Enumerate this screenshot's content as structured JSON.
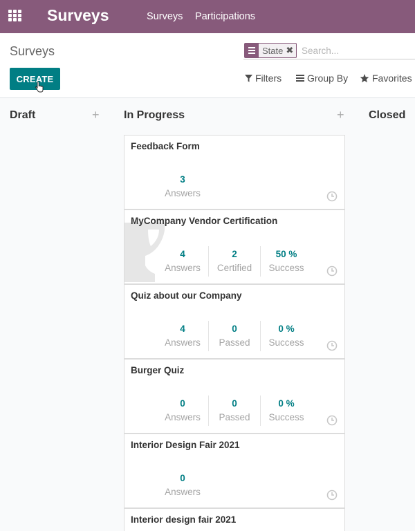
{
  "navbar": {
    "app_title": "Surveys",
    "menu": [
      "Surveys",
      "Participations"
    ]
  },
  "control_panel": {
    "breadcrumb": "Surveys",
    "search_facet_label": "State",
    "search_placeholder": "Search...",
    "create_label": "CREATE",
    "filters_label": "Filters",
    "group_by_label": "Group By",
    "favorites_label": "Favorites"
  },
  "kanban": {
    "columns": [
      {
        "title": "Draft"
      },
      {
        "title": "In Progress"
      },
      {
        "title": "Closed"
      }
    ],
    "cards": [
      {
        "title": "Feedback Form",
        "stats": [
          {
            "value": "3",
            "label": "Answers"
          }
        ]
      },
      {
        "title": "MyCompany Vendor Certification",
        "stats": [
          {
            "value": "4",
            "label": "Answers"
          },
          {
            "value": "2",
            "label": "Certified"
          },
          {
            "value": "50 %",
            "label": "Success"
          }
        ]
      },
      {
        "title": "Quiz about our Company",
        "stats": [
          {
            "value": "4",
            "label": "Answers"
          },
          {
            "value": "0",
            "label": "Passed"
          },
          {
            "value": "0 %",
            "label": "Success"
          }
        ]
      },
      {
        "title": "Burger Quiz",
        "stats": [
          {
            "value": "0",
            "label": "Answers"
          },
          {
            "value": "0",
            "label": "Passed"
          },
          {
            "value": "0 %",
            "label": "Success"
          }
        ]
      },
      {
        "title": "Interior Design Fair 2021",
        "stats": [
          {
            "value": "0",
            "label": "Answers"
          }
        ]
      },
      {
        "title": "Interior design fair 2021",
        "stats": []
      }
    ]
  },
  "colors": {
    "brand": "#875a7b",
    "primary": "#017e84",
    "stat_value": "#017e84",
    "muted_label": "#a4a4a4"
  }
}
